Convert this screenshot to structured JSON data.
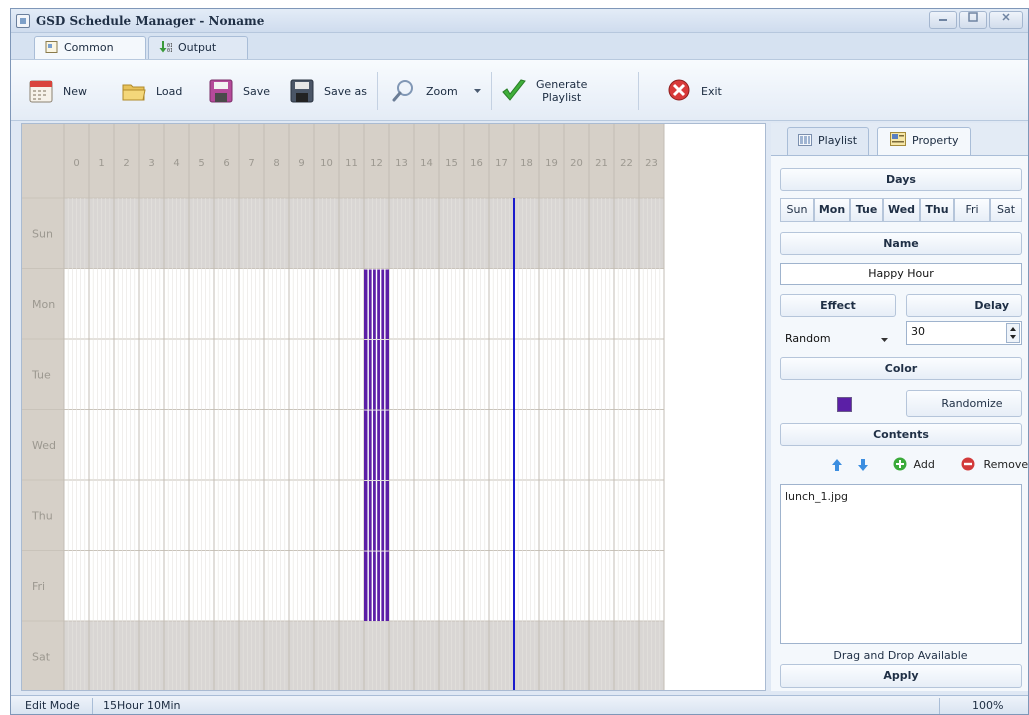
{
  "window": {
    "title": "GSD Schedule Manager - Noname"
  },
  "tabs": [
    {
      "label": "Common"
    },
    {
      "label": "Output"
    }
  ],
  "toolbar": {
    "new": "New",
    "load": "Load",
    "save": "Save",
    "save_as": "Save as",
    "zoom": "Zoom",
    "generate_line1": "Generate",
    "generate_line2": "Playlist",
    "exit": "Exit"
  },
  "schedule": {
    "hours": [
      "0",
      "1",
      "2",
      "3",
      "4",
      "5",
      "6",
      "7",
      "8",
      "9",
      "10",
      "11",
      "12",
      "13",
      "14",
      "15",
      "16",
      "17",
      "18",
      "19",
      "20",
      "21",
      "22",
      "23"
    ],
    "days": [
      "Sun",
      "Mon",
      "Tue",
      "Wed",
      "Thu",
      "Fri",
      "Sat"
    ],
    "weekend_days": [
      "Sun",
      "Sat"
    ],
    "current_time_hour": 18.0,
    "events": [
      {
        "start_hour": 12.0,
        "end_hour": 13.0,
        "days": [
          "Mon",
          "Tue",
          "Wed",
          "Thu",
          "Fri"
        ],
        "color": "#5b1fa6"
      }
    ],
    "colors": {
      "weekend": "#d9d6d4",
      "weekday": "#ffffff",
      "header": "#d6d0c8",
      "marker": "#1a1acc"
    }
  },
  "property_panel": {
    "tabs": [
      {
        "label": "Playlist"
      },
      {
        "label": "Property"
      }
    ],
    "days_header": "Days",
    "days": [
      {
        "label": "Sun",
        "selected": false
      },
      {
        "label": "Mon",
        "selected": true
      },
      {
        "label": "Tue",
        "selected": true
      },
      {
        "label": "Wed",
        "selected": true
      },
      {
        "label": "Thu",
        "selected": true
      },
      {
        "label": "Fri",
        "selected": false
      },
      {
        "label": "Sat",
        "selected": false
      }
    ],
    "name_header": "Name",
    "name_value": "Happy Hour",
    "effect_header": "Effect",
    "delay_header": "Delay",
    "effect_value": "Random",
    "delay_value": "30",
    "color_header": "Color",
    "color_value": "#5b1fa6",
    "randomize": "Randomize",
    "contents_header": "Contents",
    "add": "Add",
    "remove": "Remove",
    "contents": [
      "lunch_1.jpg"
    ],
    "drag_hint": "Drag and Drop Available",
    "apply": "Apply"
  },
  "status": {
    "mode": "Edit Mode",
    "time": "15Hour 10Min",
    "zoom": "100%"
  }
}
